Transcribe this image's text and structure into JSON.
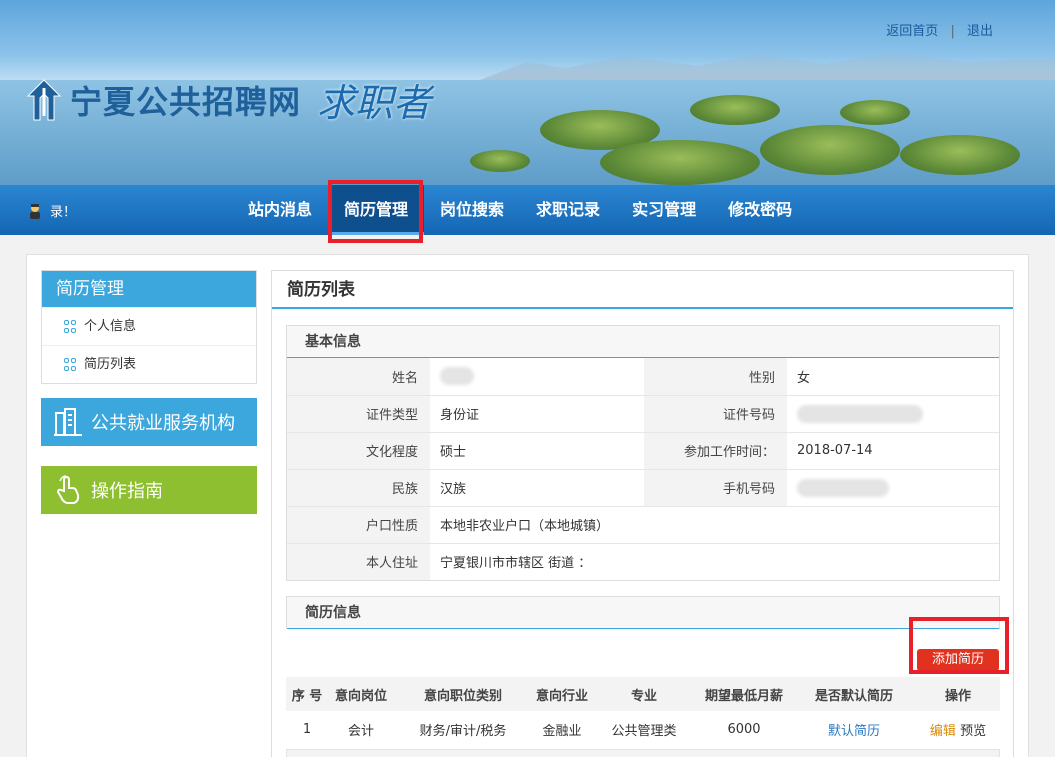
{
  "header": {
    "site_title": "宁夏公共招聘网",
    "site_subtitle": "求职者",
    "links": {
      "home": "返回首页",
      "separator": "|",
      "logout": "退出"
    }
  },
  "nav": {
    "user_text": "录！",
    "items": [
      {
        "label": "站内消息",
        "active": false
      },
      {
        "label": "简历管理",
        "active": true
      },
      {
        "label": "岗位搜索",
        "active": false
      },
      {
        "label": "求职记录",
        "active": false
      },
      {
        "label": "实习管理",
        "active": false
      },
      {
        "label": "修改密码",
        "active": false
      }
    ]
  },
  "sidebar": {
    "title": "简历管理",
    "items": [
      {
        "label": "个人信息"
      },
      {
        "label": "简历列表"
      }
    ],
    "block_public": "公共就业服务机构",
    "block_guide": "操作指南"
  },
  "content": {
    "title": "简历列表",
    "basic_info": {
      "heading": "基本信息",
      "name_label": "姓名",
      "gender_label": "性别",
      "gender_value": "女",
      "id_type_label": "证件类型",
      "id_type_value": "身份证",
      "id_no_label": "证件号码",
      "edu_label": "文化程度",
      "edu_value": "硕士",
      "work_start_label": "参加工作时间：",
      "work_start_value": "2018-07-14",
      "ethnic_label": "民族",
      "ethnic_value": "汉族",
      "phone_label": "手机号码",
      "hukou_label": "户口性质",
      "hukou_value": "本地非农业户口（本地城镇）",
      "address_label": "本人住址",
      "address_value": "宁夏银川市市辖区   街道 ："
    },
    "resume_info": {
      "heading": "简历信息",
      "add_button": "添加简历",
      "columns": [
        "序 号",
        "意向岗位",
        "意向职位类别",
        "意向行业",
        "专业",
        "期望最低月薪",
        "是否默认简历",
        "操作"
      ],
      "rows": [
        {
          "no": "1",
          "position": "会计",
          "category": "财务/审计/税务",
          "industry": "金融业",
          "major": "公共管理类",
          "salary": "6000",
          "default": "默认简历",
          "edit": "编辑",
          "preview": "预览"
        }
      ]
    }
  },
  "colors": {
    "accent": "#3ca7dc",
    "nav": "#1466b3",
    "highlight": "#e8202a",
    "guide_green": "#8dbf31",
    "add_button": "#e0321e"
  }
}
